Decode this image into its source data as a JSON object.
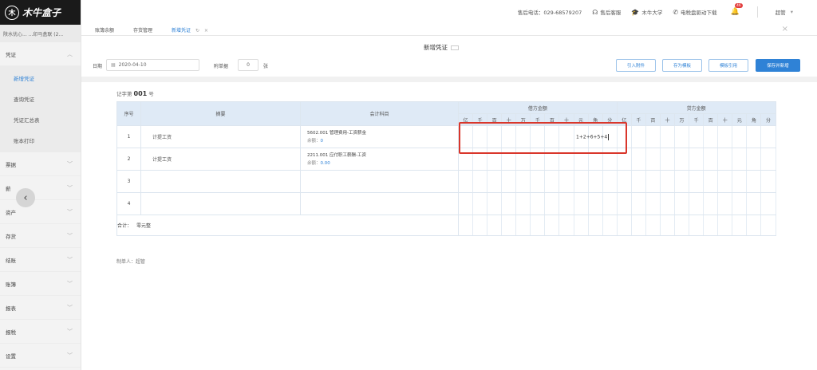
{
  "sidebar": {
    "logo_mark": "木",
    "logo_text": "木牛盒子",
    "company": "陕水优心...  ...印马盒联 (2...",
    "groups": [
      {
        "label": "凭证"
      },
      {
        "label": "票据"
      },
      {
        "label": "薪"
      },
      {
        "label": "资产"
      },
      {
        "label": "存货"
      },
      {
        "label": "结账"
      },
      {
        "label": "账簿"
      },
      {
        "label": "报表"
      },
      {
        "label": "报税"
      },
      {
        "label": "设置"
      }
    ],
    "voucher_sub": [
      "新增凭证",
      "查询凭证",
      "凭证汇总表",
      "账本打印"
    ],
    "collapse_glyph": "‹"
  },
  "topbar": {
    "hotline": "售后电话：029-68579207",
    "service": "售后客服",
    "college": "木牛大学",
    "driver": "电税盘驱动下载",
    "badge": "46",
    "user": "超管"
  },
  "tabs": [
    {
      "label": "账簿余额"
    },
    {
      "label": "存货管理"
    },
    {
      "label": "新增凭证",
      "refresh": "↻",
      "close": "×"
    }
  ],
  "tabs_close": "×",
  "voucher": {
    "title": "新增凭证",
    "date_label": "日期",
    "date_value": "2020-04-10",
    "attach_label": "附单据",
    "attach_value": "0",
    "attach_unit": "张",
    "buttons": {
      "import": "引入附件",
      "save_template": "存为模板",
      "template_import": "模板引用",
      "save_new": "保存并新增"
    },
    "no_prefix": "记字第",
    "no_value": "001",
    "no_suffix": "号"
  },
  "table": {
    "headers": {
      "index": "序号",
      "summary": "摘要",
      "subject": "会计科目",
      "debit": "借方金额",
      "credit": "贷方金额"
    },
    "digits": [
      "亿",
      "千",
      "百",
      "十",
      "万",
      "千",
      "百",
      "十",
      "元",
      "角",
      "分"
    ],
    "rows": [
      {
        "index": "1",
        "summary": "计提工资",
        "subject": "5602.001 管理费用-工资薪金",
        "balance_label": "余额：",
        "balance": "0"
      },
      {
        "index": "2",
        "summary": "计提工资",
        "subject": "2211.001 应付职工薪酬-工资",
        "balance_label": "余额：",
        "balance": "0.00"
      },
      {
        "index": "3",
        "summary": "",
        "subject": "",
        "balance_label": "",
        "balance": ""
      },
      {
        "index": "4",
        "summary": "",
        "subject": "",
        "balance_label": "",
        "balance": ""
      }
    ],
    "total_label": "合计：",
    "total_value": "零元整",
    "formula": "1+2+6+5+4"
  },
  "maker": "制单人：超管",
  "colors": {
    "accent": "#2f82d6",
    "highlight": "#d9362b",
    "header_bg": "#dfeaf6"
  }
}
